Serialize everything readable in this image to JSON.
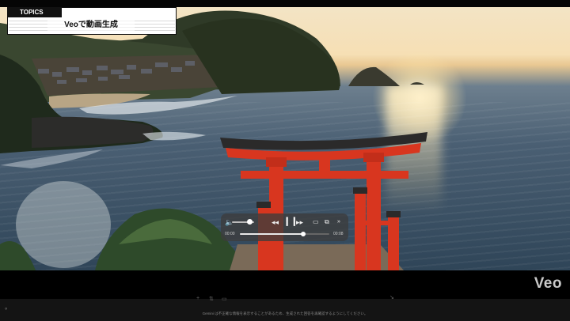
{
  "topics": {
    "tag": "TOPICS",
    "title": "Veoで動画生成"
  },
  "player": {
    "rewind_icon": "rewind-icon",
    "pause_icon": "pause-icon",
    "forward_icon": "forward-icon",
    "time_current": "00:00",
    "time_total": "00:08",
    "volume_level": 0.8,
    "progress": 0.71
  },
  "watermark": {
    "text": "Veo"
  },
  "footer": {
    "disclaimer": "Gemini は不正確な情報を表示することがあるため、生成された回答を再確認するようにしてください。"
  },
  "colors": {
    "torii": "#d8361f",
    "torii_dark": "#2b2a2a",
    "sky": "#f5dfb4",
    "sea": "#3e556a"
  }
}
